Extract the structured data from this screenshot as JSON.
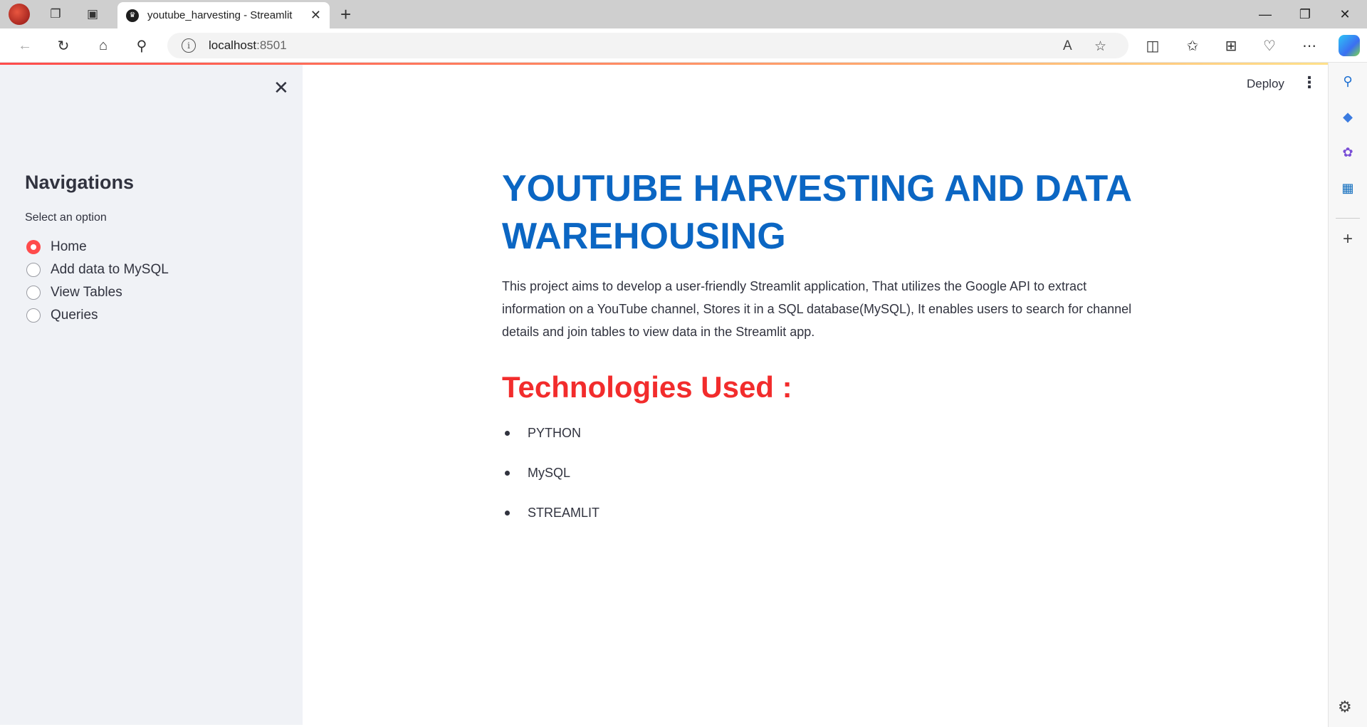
{
  "browser": {
    "tab_title": "youtube_harvesting - Streamlit",
    "url_host": "localhost",
    "url_port": ":8501"
  },
  "header": {
    "deploy_label": "Deploy"
  },
  "sidebar": {
    "title": "Navigations",
    "select_label": "Select an option",
    "options": [
      {
        "label": "Home",
        "selected": true
      },
      {
        "label": "Add data to MySQL",
        "selected": false
      },
      {
        "label": "View Tables",
        "selected": false
      },
      {
        "label": "Queries",
        "selected": false
      }
    ]
  },
  "main": {
    "title": "YOUTUBE HARVESTING AND DATA WAREHOUSING",
    "description": "This project aims to develop a user-friendly Streamlit application, That utilizes the Google API to extract information on a YouTube channel, Stores it in a SQL database(MySQL), It enables users to search for channel details and join tables to view data in the Streamlit app.",
    "tech_heading": "Technologies Used :",
    "technologies": [
      "PYTHON",
      "MySQL",
      "STREAMLIT"
    ]
  },
  "colors": {
    "title_blue": "#0b66c3",
    "heading_red": "#f22c2c",
    "accent_red": "#ff4b4b",
    "sidebar_bg": "#f0f2f6"
  }
}
